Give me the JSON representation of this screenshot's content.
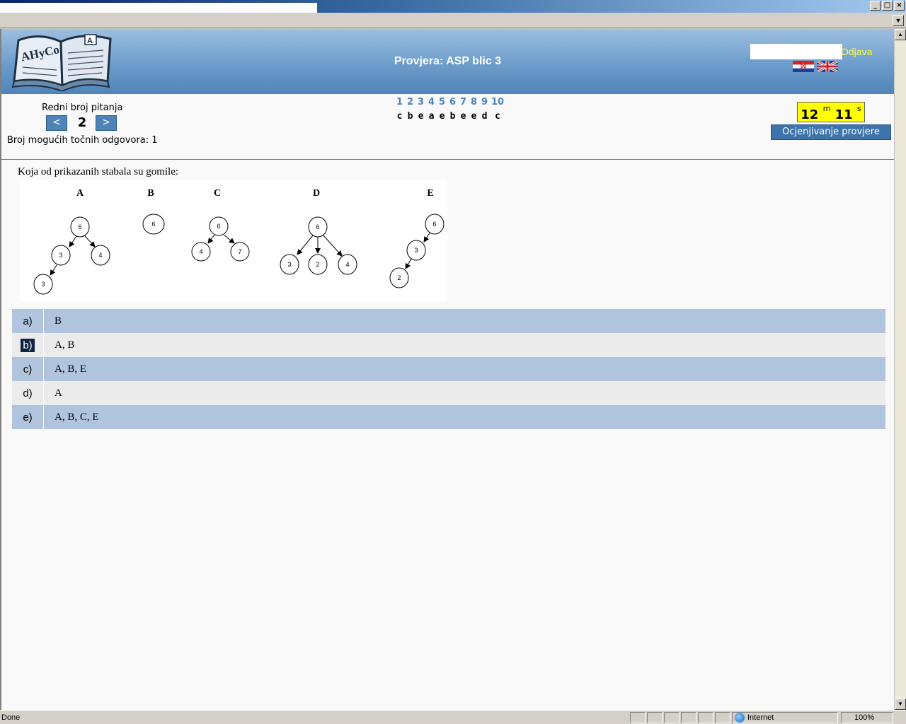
{
  "window": {
    "controls": [
      "_",
      "□",
      "×"
    ]
  },
  "header": {
    "title": "Provjera: ASP blic 3",
    "logout": "Odjava",
    "logo_text": "AHyCo"
  },
  "nav": {
    "question_label": "Redni broj pitanja",
    "prev": "<",
    "next": ">",
    "current": "2",
    "possible_correct": "Broj mogućih točnih odgovora: 1",
    "question_links": [
      "1",
      "2",
      "3",
      "4",
      "5",
      "6",
      "7",
      "8",
      "9",
      "10"
    ],
    "given_answers": [
      "c",
      "b",
      "e",
      "a",
      "e",
      "b",
      "e",
      "e",
      "d",
      "c"
    ],
    "timer_minutes": "12",
    "timer_m": "m",
    "timer_seconds": "11",
    "timer_s": "s",
    "grade_button": "Ocjenjivanje provjere"
  },
  "question": {
    "text": "Koja od prikazanih stabala su gomile:",
    "trees": [
      "A",
      "B",
      "C",
      "D",
      "E"
    ]
  },
  "answers": [
    {
      "key": "a)",
      "text": "B"
    },
    {
      "key": "b)",
      "text": "A, B"
    },
    {
      "key": "c)",
      "text": "A, B, E"
    },
    {
      "key": "d)",
      "text": "A"
    },
    {
      "key": "e)",
      "text": "A, B, C, E"
    }
  ],
  "status": {
    "left": "Done",
    "zone": "Internet",
    "zoom": "100%"
  }
}
